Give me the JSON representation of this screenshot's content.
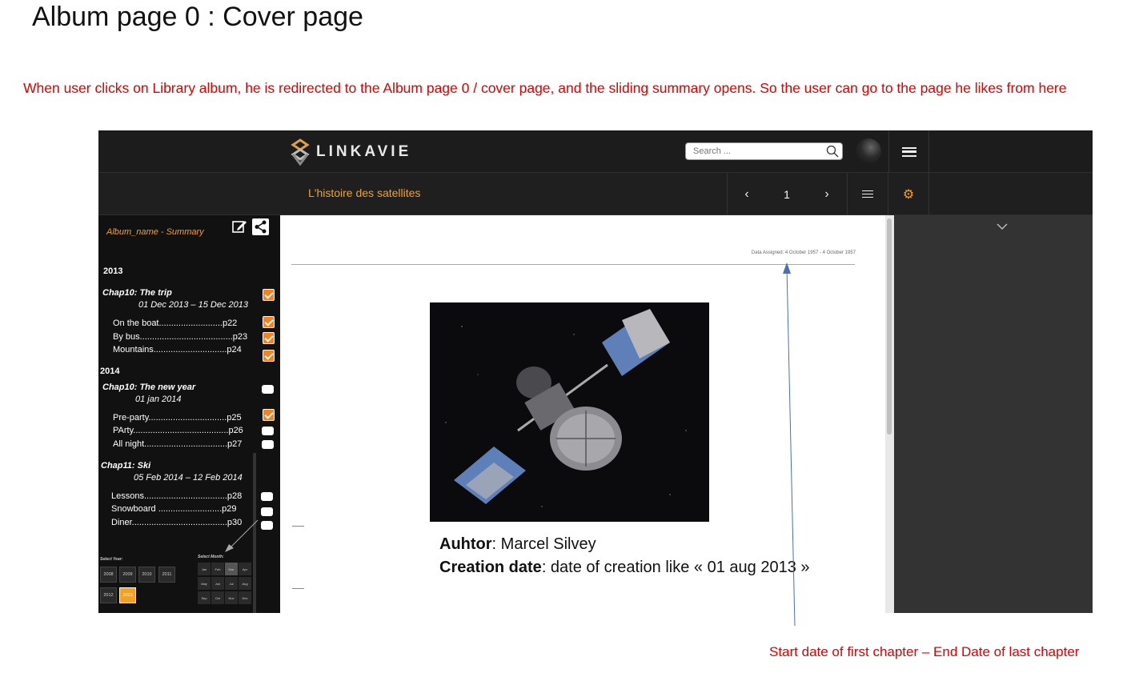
{
  "doc": {
    "title": "Album page 0 : Cover page",
    "note": "When user clicks on Library album, he is redirected to the Album page 0 / cover page, and the sliding summary opens. So the user can go to the page he likes from here",
    "bottom_note": "Start date of first chapter – End Date of last chapter"
  },
  "header": {
    "logo_text": "LINKAVIE",
    "search_placeholder": "Search ...",
    "album_title": "L'histoire des satellites",
    "prev": "‹",
    "page": "1",
    "next": "›",
    "gear": "⚙"
  },
  "sidebar": {
    "summary_label": "Album_name - Summary",
    "years": [
      {
        "label": "2013",
        "chapters": [
          {
            "title": "Chap10: The trip",
            "dates": "01 Dec 2013 – 15 Dec 2013",
            "checked": true,
            "pages": [
              {
                "label": "On the boat..........................p22",
                "checked": true
              },
              {
                "label": "By bus......................................p23",
                "checked": true
              },
              {
                "label": "Mountains..............................p24",
                "checked": true
              }
            ]
          }
        ]
      },
      {
        "label": "2014",
        "chapters": [
          {
            "title": "Chap10: The new year",
            "dates": "01 jan 2014",
            "checked": false,
            "pages": [
              {
                "label": "Pre-party................................p25",
                "checked": true
              },
              {
                "label": "PArty.......................................p26",
                "checked": false
              },
              {
                "label": "All night..................................p27",
                "checked": false
              }
            ]
          },
          {
            "title": "Chap11: Ski",
            "dates": "05 Feb 2014 – 12 Feb 2014",
            "checked": null,
            "pages": [
              {
                "label": "Lessons..................................p28",
                "checked": false
              },
              {
                "label": "Snowboard ..........................p29",
                "checked": false
              },
              {
                "label": "Diner.......................................p30",
                "checked": false
              }
            ]
          }
        ]
      }
    ],
    "select_year_label": "Select Year:",
    "select_month_label": "Select Month:",
    "year_buttons": [
      "2008",
      "2009",
      "2010",
      "2011",
      "2012",
      "2013"
    ],
    "selected_year": "2013",
    "month_buttons": [
      "Jan",
      "Feb",
      "Mar",
      "Apr",
      "May",
      "Jun",
      "Jul",
      "Aug",
      "Sep",
      "Oct",
      "Nov",
      "Dec"
    ],
    "selected_month": "Mar"
  },
  "main": {
    "dates_line": "Data Assigned: 4 October 1957 - 4 October 1957",
    "author_label": "Auhtor",
    "author_value": ": Marcel Silvey",
    "creation_label": "Creation date",
    "creation_value": ": date of creation like « 01 aug 2013 »"
  },
  "colors": {
    "accent_orange": "#f58220",
    "annotation_red": "#e00000",
    "arrow_blue": "#4a6fb5"
  }
}
